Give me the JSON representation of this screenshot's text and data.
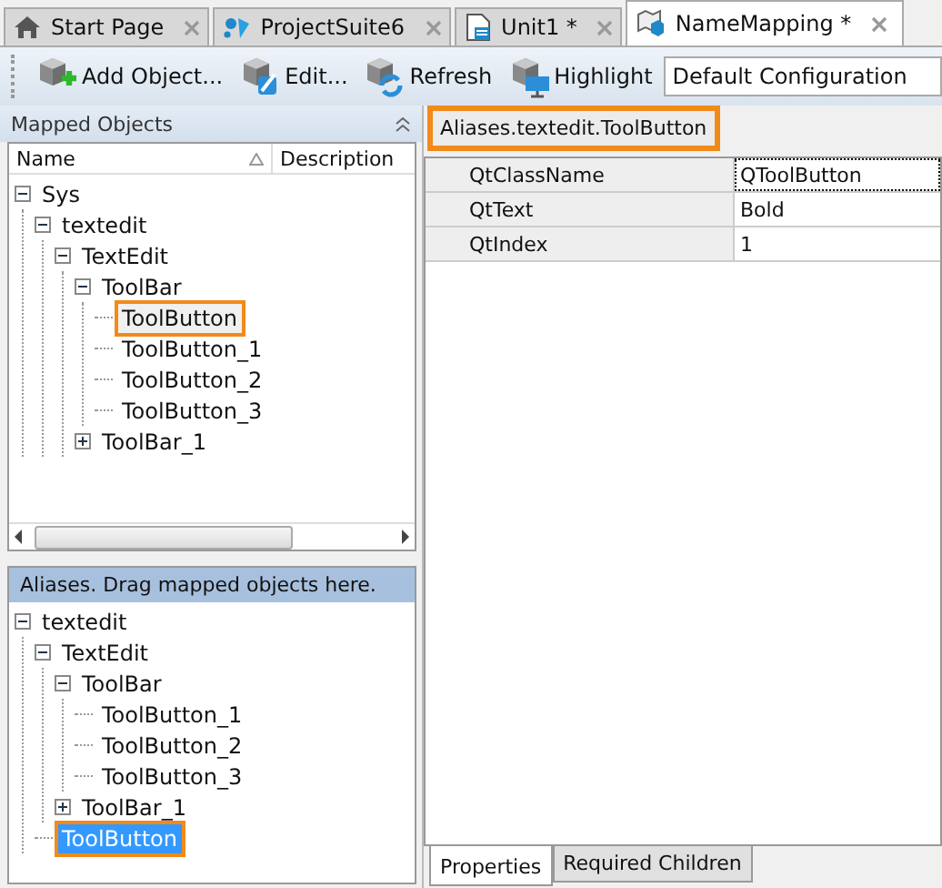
{
  "tabs": [
    {
      "label": "Start Page",
      "selected": false
    },
    {
      "label": "ProjectSuite6",
      "selected": false
    },
    {
      "label": "Unit1 *",
      "selected": false
    },
    {
      "label": "NameMapping *",
      "selected": true
    }
  ],
  "toolbar": {
    "buttons": [
      {
        "label": "Add Object..."
      },
      {
        "label": "Edit..."
      },
      {
        "label": "Refresh"
      },
      {
        "label": "Highlight"
      }
    ],
    "configuration": "Default Configuration"
  },
  "mapped_objects": {
    "title": "Mapped Objects",
    "columns": [
      "Name",
      "Description"
    ],
    "tree": [
      {
        "label": "Sys",
        "expanded": true,
        "selected": false,
        "highlighted": false,
        "children": [
          {
            "label": "textedit",
            "expanded": true,
            "selected": false,
            "highlighted": false,
            "children": [
              {
                "label": "TextEdit",
                "expanded": true,
                "selected": false,
                "highlighted": false,
                "children": [
                  {
                    "label": "ToolBar",
                    "expanded": true,
                    "selected": false,
                    "highlighted": false,
                    "children": [
                      {
                        "label": "ToolButton",
                        "selected": false,
                        "highlighted": true
                      },
                      {
                        "label": "ToolButton_1",
                        "selected": false,
                        "highlighted": false
                      },
                      {
                        "label": "ToolButton_2",
                        "selected": false,
                        "highlighted": false
                      },
                      {
                        "label": "ToolButton_3",
                        "selected": false,
                        "highlighted": false
                      }
                    ]
                  },
                  {
                    "label": "ToolBar_1",
                    "expanded": false,
                    "selected": false,
                    "highlighted": false
                  }
                ]
              }
            ]
          }
        ]
      }
    ]
  },
  "aliases": {
    "title": "Aliases. Drag mapped objects here.",
    "tree": [
      {
        "label": "textedit",
        "expanded": true,
        "selected": false,
        "highlighted": false,
        "children": [
          {
            "label": "TextEdit",
            "expanded": true,
            "selected": false,
            "highlighted": false,
            "children": [
              {
                "label": "ToolBar",
                "expanded": true,
                "selected": false,
                "highlighted": false,
                "children": [
                  {
                    "label": "ToolButton_1",
                    "selected": false,
                    "highlighted": false
                  },
                  {
                    "label": "ToolButton_2",
                    "selected": false,
                    "highlighted": false
                  },
                  {
                    "label": "ToolButton_3",
                    "selected": false,
                    "highlighted": false
                  }
                ]
              },
              {
                "label": "ToolBar_1",
                "expanded": false,
                "selected": false,
                "highlighted": false
              }
            ]
          },
          {
            "label": "ToolButton",
            "selected": true,
            "highlighted": true
          }
        ]
      }
    ]
  },
  "details": {
    "path": "Aliases.textedit.ToolButton",
    "properties": [
      {
        "name": "QtClassName",
        "value": "QToolButton",
        "focused": true
      },
      {
        "name": "QtText",
        "value": "Bold",
        "focused": false
      },
      {
        "name": "QtIndex",
        "value": "1",
        "focused": false
      }
    ],
    "bottom_tabs": [
      {
        "label": "Properties",
        "selected": true
      },
      {
        "label": "Required Children",
        "selected": false
      }
    ]
  }
}
